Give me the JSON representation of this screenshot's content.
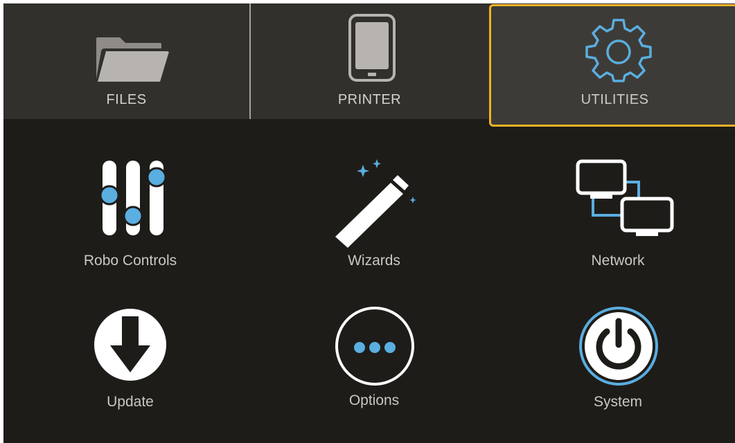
{
  "tabs": [
    {
      "label": "FILES",
      "icon": "folder-icon",
      "selected": false
    },
    {
      "label": "PRINTER",
      "icon": "tablet-icon",
      "selected": false
    },
    {
      "label": "UTILITIES",
      "icon": "gear-icon",
      "selected": true
    }
  ],
  "menu": [
    {
      "label": "Robo Controls",
      "icon": "sliders-icon"
    },
    {
      "label": "Wizards",
      "icon": "magic-wand-icon"
    },
    {
      "label": "Network",
      "icon": "network-icon"
    },
    {
      "label": "Update",
      "icon": "download-arrow-icon"
    },
    {
      "label": "Options",
      "icon": "more-dots-icon"
    },
    {
      "label": "System",
      "icon": "power-icon"
    }
  ],
  "colors": {
    "background": "#1e1c19",
    "tab_bar": "#32302d",
    "selected_tab": "#3d3b37",
    "selected_border": "#f0b324",
    "accent_blue": "#5aaee0",
    "label_text": "#cbc7c1"
  }
}
